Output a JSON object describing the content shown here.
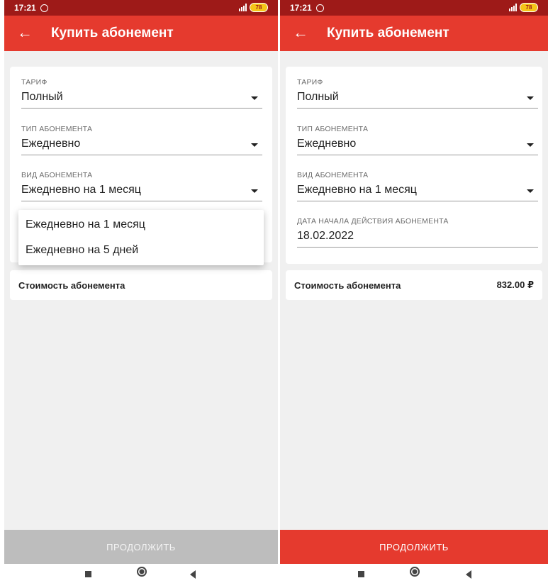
{
  "screens": [
    {
      "status": {
        "time": "17:21",
        "battery": "78"
      },
      "appbar": {
        "title": "Купить абонемент"
      },
      "fields": [
        {
          "label": "ТАРИФ",
          "value": "Полный"
        },
        {
          "label": "ТИП АБОНЕМЕНТА",
          "value": "Ежедневно"
        },
        {
          "label": "ВИД АБОНЕМЕНТА",
          "value": "Ежедневно на 1 месяц"
        }
      ],
      "dropdown_options": [
        "Ежедневно на 1 месяц",
        "Ежедневно на 5 дней"
      ],
      "cost": {
        "label": "Стоимость абонемента",
        "value": ""
      },
      "continue_label": "ПРОДОЛЖИТЬ"
    },
    {
      "status": {
        "time": "17:21",
        "battery": "78"
      },
      "appbar": {
        "title": "Купить абонемент"
      },
      "fields": [
        {
          "label": "ТАРИФ",
          "value": "Полный"
        },
        {
          "label": "ТИП АБОНЕМЕНТА",
          "value": "Ежедневно"
        },
        {
          "label": "ВИД АБОНЕМЕНТА",
          "value": "Ежедневно на 1 месяц"
        },
        {
          "label": "ДАТА НАЧАЛА ДЕЙСТВИЯ АБОНЕМЕНТА",
          "value": "18.02.2022"
        }
      ],
      "cost": {
        "label": "Стоимость абонемента",
        "value": "832.00 ₽"
      },
      "continue_label": "ПРОДОЛЖИТЬ"
    }
  ],
  "colors": {
    "primary": "#e53a2e",
    "statusbar": "#9e1a18",
    "disabled": "#bdbdbd",
    "battery": "#f5c518"
  }
}
